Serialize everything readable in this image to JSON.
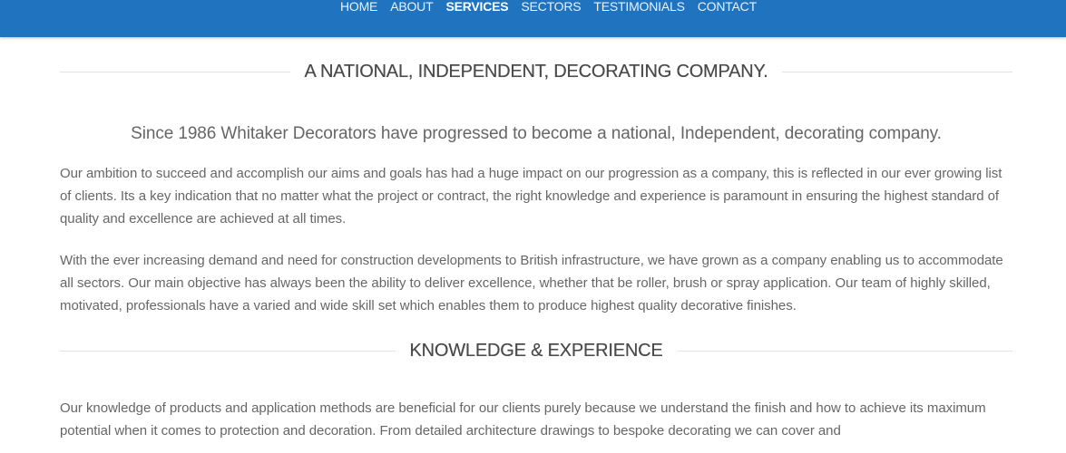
{
  "nav": {
    "items": [
      {
        "label": "HOME"
      },
      {
        "label": "ABOUT"
      },
      {
        "label": "SERVICES"
      },
      {
        "label": "SECTORS"
      },
      {
        "label": "TESTIMONIALS"
      },
      {
        "label": "CONTACT"
      }
    ],
    "active": "SERVICES"
  },
  "colors": {
    "nav_background": "#1f73bf",
    "heading_text": "#4a4a4a",
    "body_text": "#666666",
    "rule": "#e2e2e2"
  },
  "section1": {
    "heading": "A NATIONAL, INDEPENDENT, DECORATING COMPANY.",
    "lead": "Since 1986 Whitaker Decorators have progressed to become a national, Independent, decorating company.",
    "paragraphs": [
      "Our ambition to succeed and accomplish our aims and goals has had a huge impact on our progression as a company, this is reflected in our ever growing list of clients. Its a key indication that no matter what the project or contract, the right knowledge and experience is paramount in ensuring the highest standard of quality and excellence are achieved at all times.",
      "With the ever increasing demand and need for construction developments to British infrastructure, we have grown as a company enabling us to accommodate all sectors. Our main objective has always been the ability to deliver excellence, whether that be roller, brush or spray application. Our team of highly skilled, motivated, professionals have a varied and wide skill set which enables them to produce highest quality decorative finishes."
    ]
  },
  "section2": {
    "heading": "KNOWLEDGE & EXPERIENCE",
    "paragraphs": [
      "Our knowledge of products and application methods are beneficial for our clients purely because we understand the finish and how to achieve its maximum potential when it comes to protection and decoration. From detailed architecture drawings to bespoke decorating we can cover and"
    ]
  }
}
